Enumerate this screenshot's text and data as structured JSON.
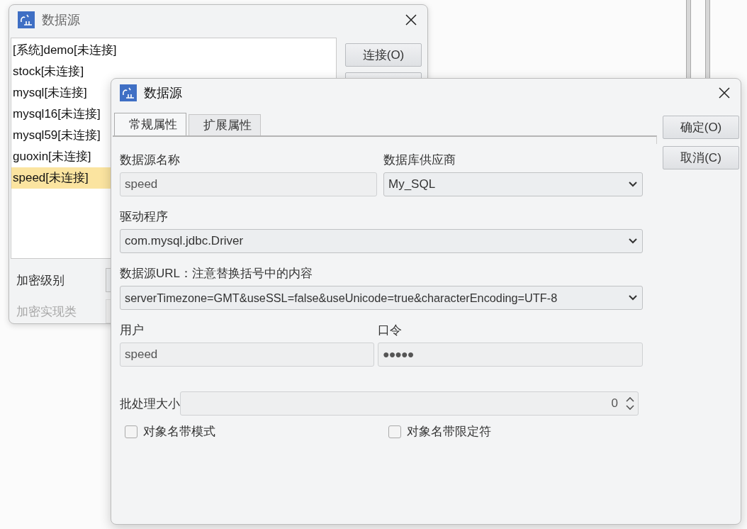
{
  "back_window": {
    "title": "数据源",
    "datasources": [
      {
        "label": "[系统]demo[未连接]",
        "selected": false
      },
      {
        "label": "stock[未连接]",
        "selected": false
      },
      {
        "label": "mysql[未连接]",
        "selected": false
      },
      {
        "label": "mysql16[未连接]",
        "selected": false
      },
      {
        "label": "mysql59[未连接]",
        "selected": false
      },
      {
        "label": "guoxin[未连接]",
        "selected": false
      },
      {
        "label": "speed[未连接]",
        "selected": true
      }
    ],
    "buttons": [
      {
        "label": "连接(O)"
      }
    ],
    "encryption_level": {
      "label": "加密级别",
      "disabled": false
    },
    "encryption_class": {
      "label": "加密实现类",
      "disabled": true
    }
  },
  "dialog": {
    "title": "数据源",
    "tabs": [
      {
        "label": "常规属性",
        "selected": true
      },
      {
        "label": "扩展属性",
        "selected": false
      }
    ],
    "buttons": [
      {
        "label": "确定(O)"
      },
      {
        "label": "取消(C)"
      }
    ],
    "name": {
      "label": "数据源名称",
      "value": "speed"
    },
    "vendor": {
      "label": "数据库供应商",
      "value": "My_SQL"
    },
    "driver": {
      "label": "驱动程序",
      "value": "com.mysql.jdbc.Driver"
    },
    "url": {
      "label": "数据源URL：注意替换括号中的内容",
      "value": "serverTimezone=GMT&useSSL=false&useUnicode=true&characterEncoding=UTF-8"
    },
    "user": {
      "label": "用户",
      "value": "speed"
    },
    "password": {
      "label": "口令",
      "mask": "●●●●●"
    },
    "batch_size": {
      "label": "批处理大小",
      "value": "0"
    },
    "checkboxes": [
      {
        "label": "对象名带模式",
        "checked": false
      },
      {
        "label": "对象名带限定符",
        "checked": false
      }
    ]
  }
}
